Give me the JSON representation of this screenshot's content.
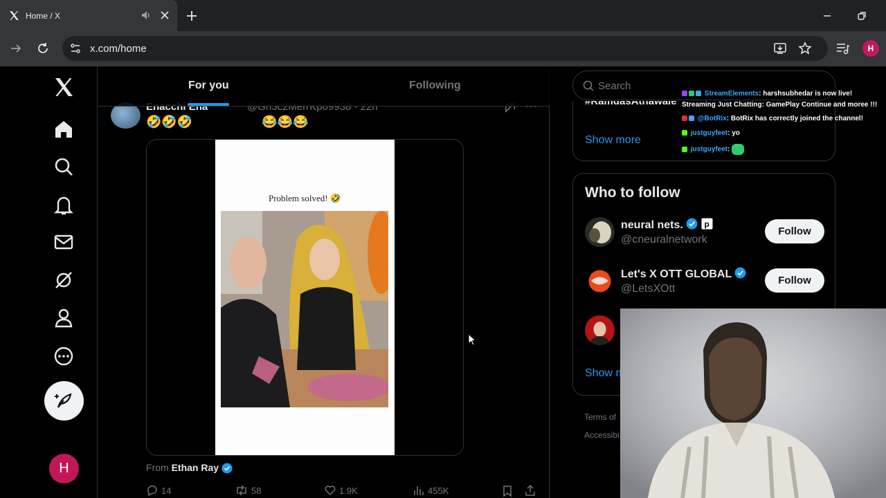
{
  "browser": {
    "tab_title": "Home / X",
    "url": "x.com/home",
    "profile_initial": "H"
  },
  "nav": {
    "icons": [
      "x-logo-icon",
      "home-icon",
      "explore-icon",
      "notifications-icon",
      "messages-icon",
      "grok-icon",
      "profile-icon",
      "more-icon"
    ],
    "avatar_initial": "H"
  },
  "timeline": {
    "tabs": [
      "For you",
      "Following"
    ],
    "active_tab": "For you"
  },
  "tweet": {
    "name": "Enacchi Ena",
    "handle": "@Gn3c2MerrKpo9938 · 22h",
    "text": "🤣🤣🤣                    😂😂😂",
    "video_caption": "Problem solved! 🤣",
    "from_label": "From",
    "from_name": "Ethan Ray",
    "replies": "14",
    "reposts": "58",
    "likes": "1.9K",
    "views": "455K"
  },
  "sidebar": {
    "search_placeholder": "Search",
    "trend_partial": "#RamdasAthawale",
    "trends_show_more": "Show more",
    "who_to_follow_title": "Who to follow",
    "suggestions": [
      {
        "name": "neural nets.",
        "handle": "@cneuralnetwork",
        "button": "Follow"
      },
      {
        "name": "Let's X OTT GLOBAL",
        "handle": "@LetsXOtt",
        "button": "Follow"
      }
    ],
    "wtf_show_more": "Show m",
    "footer_terms": "Terms of",
    "footer_access": "Accessibi"
  },
  "chat": {
    "lines": [
      {
        "user": "StreamElements",
        "text": ": harshsubhedar is now live!"
      },
      {
        "user": "",
        "text": "Streaming Just Chatting: GamePlay Continue and moree !!!"
      },
      {
        "user": "@BotRix",
        "text": ": BotRix has correctly joined the channel!"
      },
      {
        "user": "justguyfeet",
        "text": ": yo"
      },
      {
        "user": "justguyfeet",
        "text": ":"
      }
    ]
  },
  "colors": {
    "accent": "#1d9bf0",
    "verified": "#1d9bf0",
    "avatar": "#c2185b"
  }
}
